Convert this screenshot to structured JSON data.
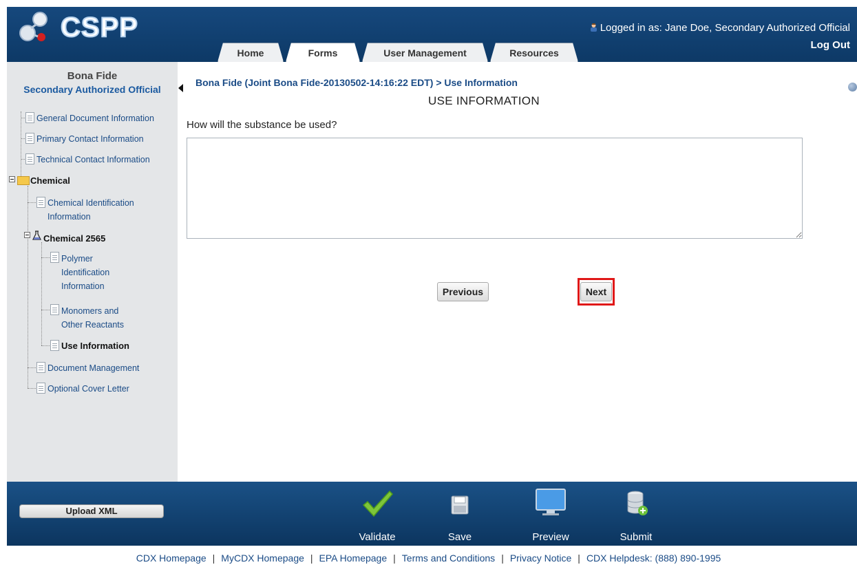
{
  "header": {
    "logo_text": "CSPP",
    "logged_in_prefix": "Logged in as:",
    "logged_in_user": "Jane Doe, Secondary Authorized Official",
    "logout_label": "Log Out",
    "tabs": [
      {
        "label": "Home",
        "active": false
      },
      {
        "label": "Forms",
        "active": true
      },
      {
        "label": "User Management",
        "active": false
      },
      {
        "label": "Resources",
        "active": false
      }
    ]
  },
  "sidebar": {
    "title": "Bona Fide",
    "subtitle": "Secondary Authorized Official",
    "items": {
      "general": "General Document Information",
      "primary": "Primary Contact Information",
      "technical": "Technical Contact Information",
      "chemical": "Chemical",
      "chem_id_1": "Chemical Identification",
      "chem_id_2": "Information",
      "chemical_2565": "Chemical 2565",
      "polymer_1": "Polymer",
      "polymer_2": "Identification",
      "polymer_3": "Information",
      "monomers_1": "Monomers and",
      "monomers_2": "Other Reactants",
      "use_info": "Use Information",
      "doc_mgmt": "Document Management",
      "cover_letter": "Optional Cover Letter"
    }
  },
  "main": {
    "breadcrumb": "Bona Fide (Joint Bona Fide-20130502-14:16:22 EDT) > Use Information",
    "title": "USE INFORMATION",
    "question": "How will the substance be used?",
    "answer_value": "",
    "previous_label": "Previous",
    "next_label": "Next"
  },
  "footer": {
    "upload_label": "Upload XML",
    "tools": {
      "validate": "Validate",
      "save": "Save",
      "preview": "Preview",
      "submit": "Submit"
    },
    "links": {
      "cdx_home": "CDX Homepage",
      "mycdx_home": "MyCDX Homepage",
      "epa_home": "EPA Homepage",
      "terms": "Terms and Conditions",
      "privacy": "Privacy Notice",
      "helpdesk": "CDX Helpdesk: (888) 890-1995"
    }
  },
  "colors": {
    "header_blue": "#16487d",
    "link_blue": "#1a4b86",
    "highlight_red": "#e01818",
    "sidebar_gray": "#e4e6e8"
  }
}
